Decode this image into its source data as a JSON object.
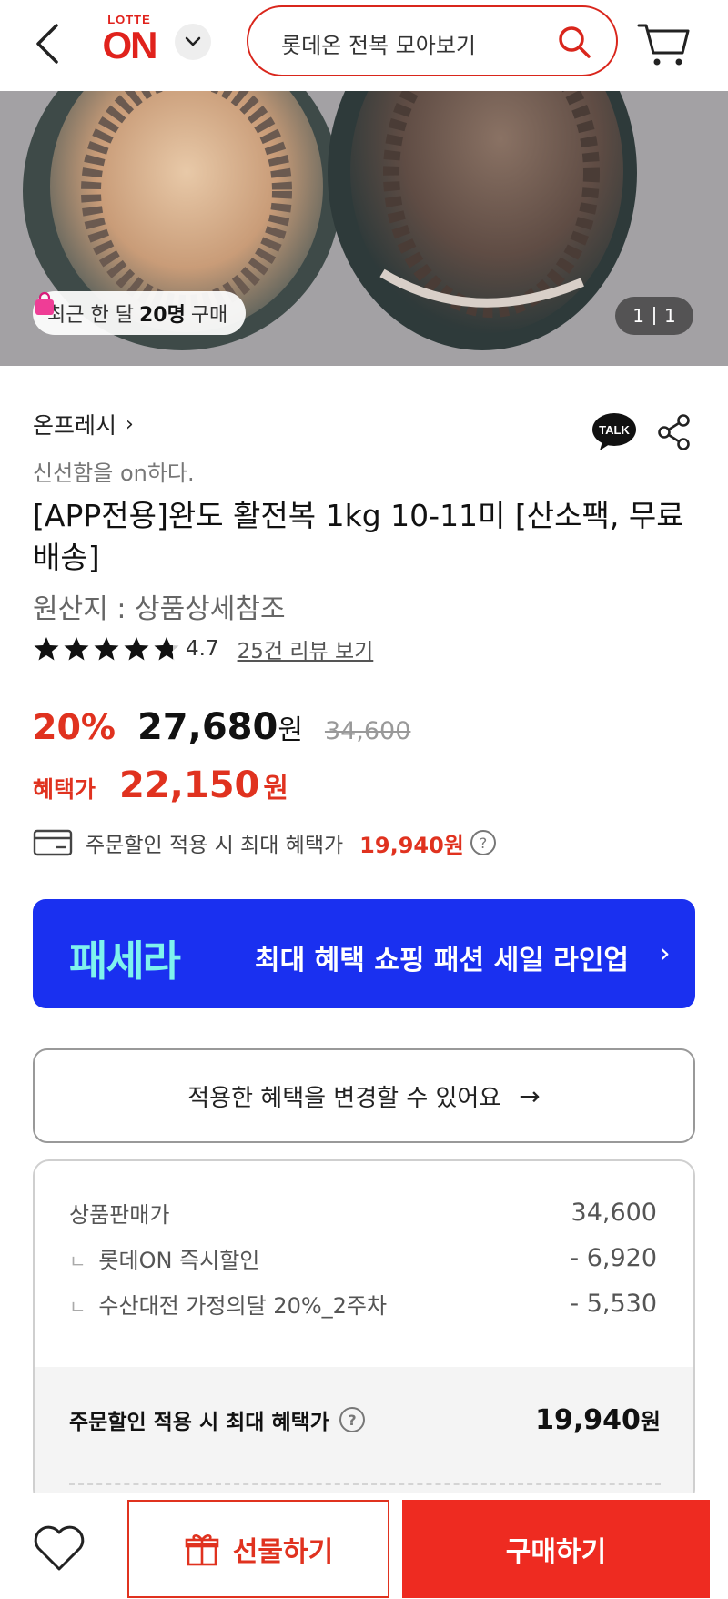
{
  "header": {
    "logo_top": "LOTTE",
    "logo_main": "ON",
    "search_text": "롯데온 전복 모아보기"
  },
  "hero": {
    "recent_prefix": "최근 한 달",
    "recent_count": "20명",
    "recent_suffix": "구매",
    "counter_current": "1",
    "counter_total": "1"
  },
  "product": {
    "store": "온프레시",
    "store_chevron": "›",
    "tagline": "신선함을 on하다.",
    "title": "[APP전용]완도 활전복 1kg 10-11미 [산소팩, 무료배송]",
    "origin": "원산지 : 상품상세참조",
    "rating": 4.7,
    "rating_text": "4.7",
    "review_link": "25건 리뷰 보기"
  },
  "price": {
    "discount_rate": "20%",
    "sale_price": "27,680",
    "won": "원",
    "original_price": "34,600",
    "benefit_label": "혜택가",
    "benefit_price": "22,150",
    "benefit_won": "원"
  },
  "card_benefit": {
    "text": "주문할인 적용 시 최대 혜택가",
    "price": "19,940원"
  },
  "banner": {
    "logo": "패세라",
    "text": "최대 혜택 쇼핑 패션 세일 라인업",
    "chevron": "›"
  },
  "change_benefit": {
    "label": "적용한 혜택을 변경할 수 있어요",
    "arrow": "→"
  },
  "breakdown": {
    "rows": [
      {
        "label": "상품판매가",
        "value": "34,600"
      },
      {
        "label": "롯데ON 즉시할인",
        "value": "- 6,920"
      },
      {
        "label": "수산대전 가정의달 20%_2주차",
        "value": "- 5,530"
      }
    ],
    "sub_marker": "ㄴ",
    "total_label": "주문할인 적용 시 최대 혜택가",
    "total_value": "19,940",
    "total_won": "원"
  },
  "bottom": {
    "gift_label": "선물하기",
    "buy_label": "구매하기"
  },
  "icons": {
    "back": "back-arrow-icon",
    "toggle": "chevron-down-icon",
    "search": "search-icon",
    "cart": "cart-icon",
    "bag": "shopping-bag-icon",
    "talk": "kakaotalk-icon",
    "share": "share-icon",
    "star": "star-icon",
    "card": "credit-card-icon",
    "help": "question-icon",
    "heart": "heart-icon",
    "gift": "gift-icon"
  },
  "colors": {
    "brand_red": "#e0221c",
    "price_red": "#e0321f",
    "buy_red": "#ee2b21",
    "banner_blue": "#1a30f0",
    "banner_logo": "#7ff2ee"
  }
}
